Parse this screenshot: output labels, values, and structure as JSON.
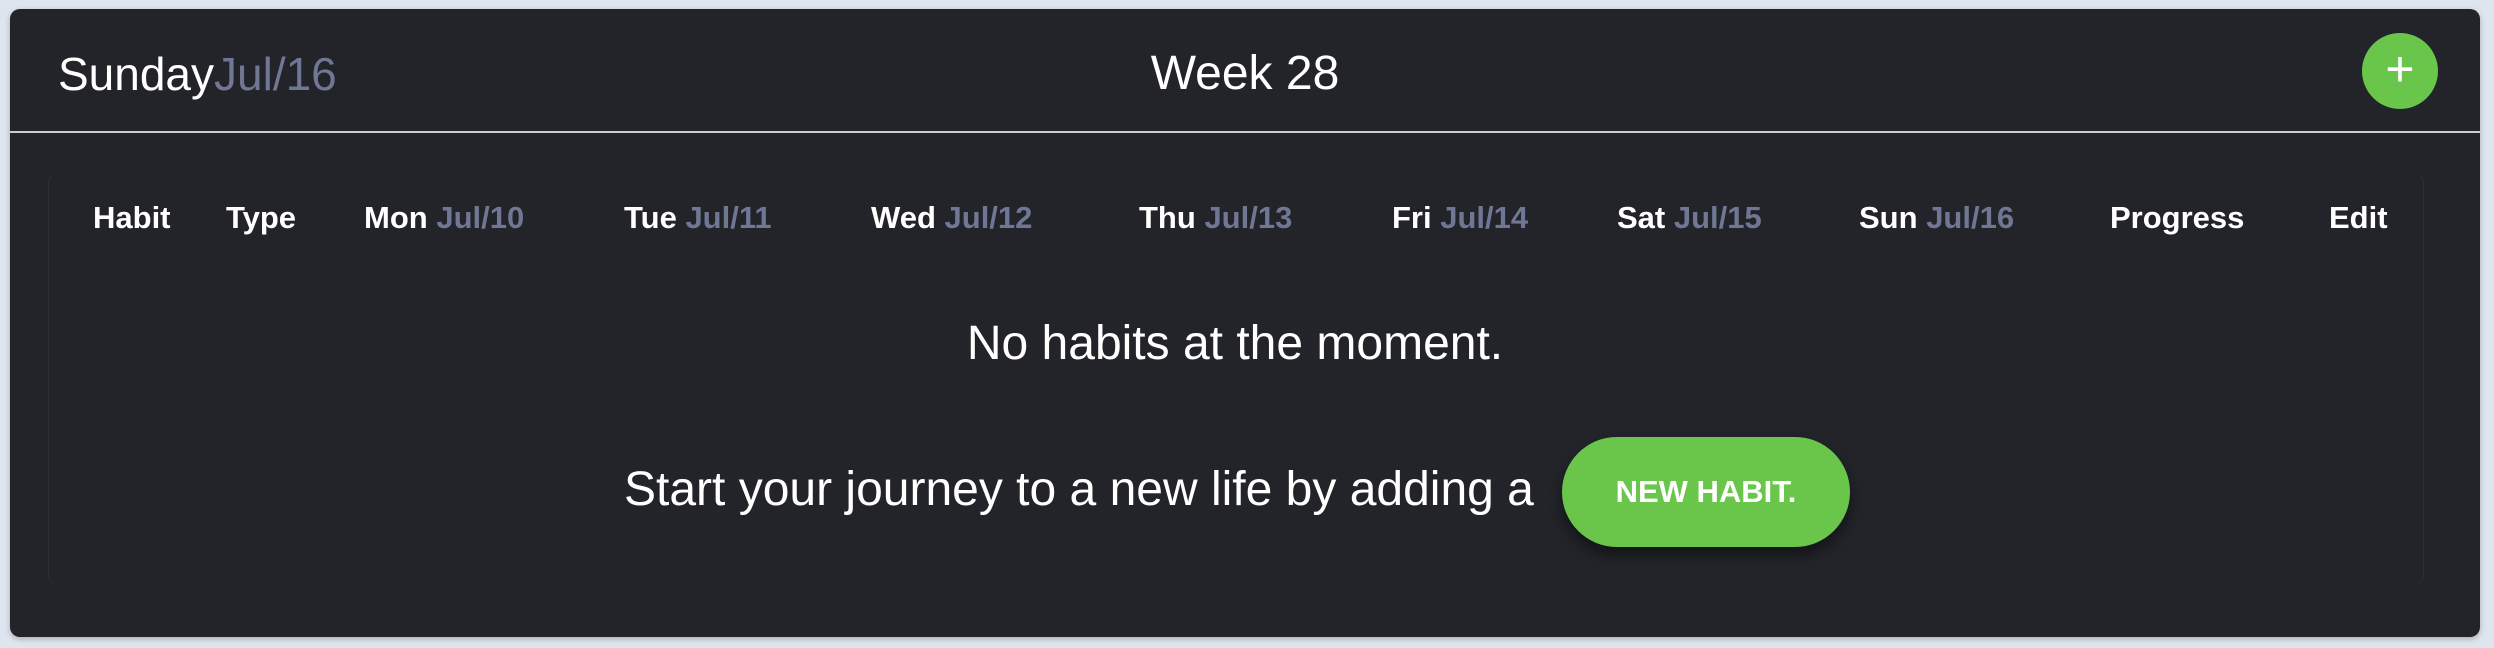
{
  "header": {
    "day_name": "Sunday",
    "day_date": "Jul/16",
    "week_title": "Week 28",
    "add_button_symbol": "+",
    "add_button_icon": "plus-icon"
  },
  "table": {
    "columns": [
      {
        "label": "Habit",
        "date": ""
      },
      {
        "label": "Type",
        "date": ""
      },
      {
        "label": "Mon",
        "date": "Jul/10"
      },
      {
        "label": "Tue",
        "date": "Jul/11"
      },
      {
        "label": "Wed",
        "date": "Jul/12"
      },
      {
        "label": "Thu",
        "date": "Jul/13"
      },
      {
        "label": "Fri",
        "date": "Jul/14"
      },
      {
        "label": "Sat",
        "date": "Jul/15"
      },
      {
        "label": "Sun",
        "date": "Jul/16"
      },
      {
        "label": "Progress",
        "date": ""
      },
      {
        "label": "Edit",
        "date": ""
      }
    ]
  },
  "empty_state": {
    "title": "No habits at the moment.",
    "cta_text": "Start your journey to a new life by adding a",
    "cta_button": "NEW HABIT."
  },
  "colors": {
    "page_background": "#dfe5ef",
    "panel_background": "#222429",
    "accent_green": "#69c64a",
    "muted_date": "#6f7794",
    "text": "#ffffff"
  }
}
